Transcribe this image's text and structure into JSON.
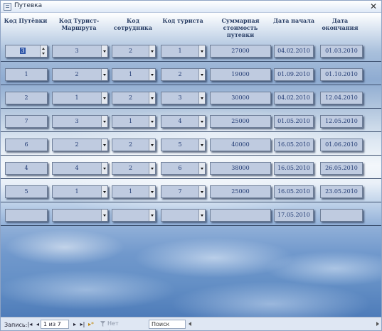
{
  "window": {
    "title": "Путевка",
    "close_glyph": "✕"
  },
  "columns": [
    "Код Путёвки",
    "Код Турист-\nМаршрута",
    "Код сотрудника",
    "Код туриста",
    "Суммарная\nстоимость путевки",
    "Дата начала",
    "Дата окончания"
  ],
  "rows": [
    {
      "code": "3",
      "route": "3",
      "employee": "2",
      "tourist": "1",
      "cost": "27000",
      "start": "04.02.2010",
      "end": "01.03.2010"
    },
    {
      "code": "1",
      "route": "2",
      "employee": "1",
      "tourist": "2",
      "cost": "19000",
      "start": "01.09.2010",
      "end": "01.10.2010"
    },
    {
      "code": "2",
      "route": "1",
      "employee": "2",
      "tourist": "3",
      "cost": "30000",
      "start": "04.02.2010",
      "end": "12.04.2010"
    },
    {
      "code": "7",
      "route": "3",
      "employee": "1",
      "tourist": "4",
      "cost": "25000",
      "start": "01.05.2010",
      "end": "12.05.2010"
    },
    {
      "code": "6",
      "route": "2",
      "employee": "2",
      "tourist": "5",
      "cost": "40000",
      "start": "16.05.2010",
      "end": "01.06.2010"
    },
    {
      "code": "4",
      "route": "4",
      "employee": "2",
      "tourist": "6",
      "cost": "38000",
      "start": "16.05.2010",
      "end": "26.05.2010"
    },
    {
      "code": "5",
      "route": "1",
      "employee": "1",
      "tourist": "7",
      "cost": "25000",
      "start": "16.05.2010",
      "end": "23.05.2010"
    },
    {
      "code": "",
      "route": "",
      "employee": "",
      "tourist": "",
      "cost": "",
      "start": "17.05.2010",
      "end": ""
    }
  ],
  "navigator": {
    "record_label": "Запись:",
    "first": "|◂",
    "prev": "◂",
    "record_value": "1 из 7",
    "next": "▸",
    "last": "▸|",
    "new": "▸*",
    "filter_label": "Нет фильтра",
    "search_value": "Поиск"
  }
}
